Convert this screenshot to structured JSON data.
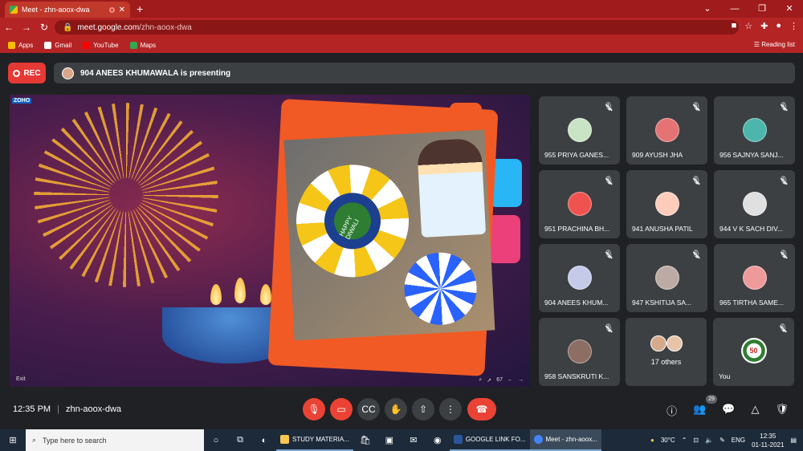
{
  "browser": {
    "tab_title": "Meet - zhn-aoox-dwa",
    "new_tab": "+",
    "url_domain": "meet.google.com",
    "url_path": "/zhn-aoox-dwa",
    "bookmarks": [
      "Apps",
      "Gmail",
      "YouTube",
      "Maps"
    ],
    "reading_list": "Reading list"
  },
  "meet": {
    "rec_label": "REC",
    "presenting_text": "904 ANEES KHUMAWALA is presenting",
    "slide": {
      "brand": "ZOHO",
      "rangoli_text": "HAPPY DIWALI",
      "exit_label": "Exit",
      "zoom": "67"
    },
    "participants": [
      "955 PRIYA GANES...",
      "909 AYUSH JHA",
      "956 SAJNYA SANJ...",
      "951 PRACHINA BH...",
      "941 ANUSHA PATIL",
      "944 V K SACH DIV...",
      "904 ANEES KHUM...",
      "947 KSHITIJA SA...",
      "965 TIRTHA SAME...",
      "958 SANSKRUTI K..."
    ],
    "others_label": "17 others",
    "you_label": "You",
    "you_avatar_text": "50",
    "time": "12:35 PM",
    "meeting_code": "zhn-aoox-dwa",
    "participant_count": "29"
  },
  "taskbar": {
    "search_placeholder": "Type here to search",
    "apps": [
      "STUDY MATERIA...",
      "GOOGLE LINK FO...",
      "Meet - zhn-aoox..."
    ],
    "weather": "30°C",
    "lang": "ENG",
    "time": "12:35",
    "date": "01-11-2021"
  },
  "colors": {
    "tab_bar": "#a01b1b",
    "toolbar": "#b52424",
    "meet_bg": "#202124",
    "tile_bg": "#3c4043",
    "danger": "#ea4335"
  }
}
